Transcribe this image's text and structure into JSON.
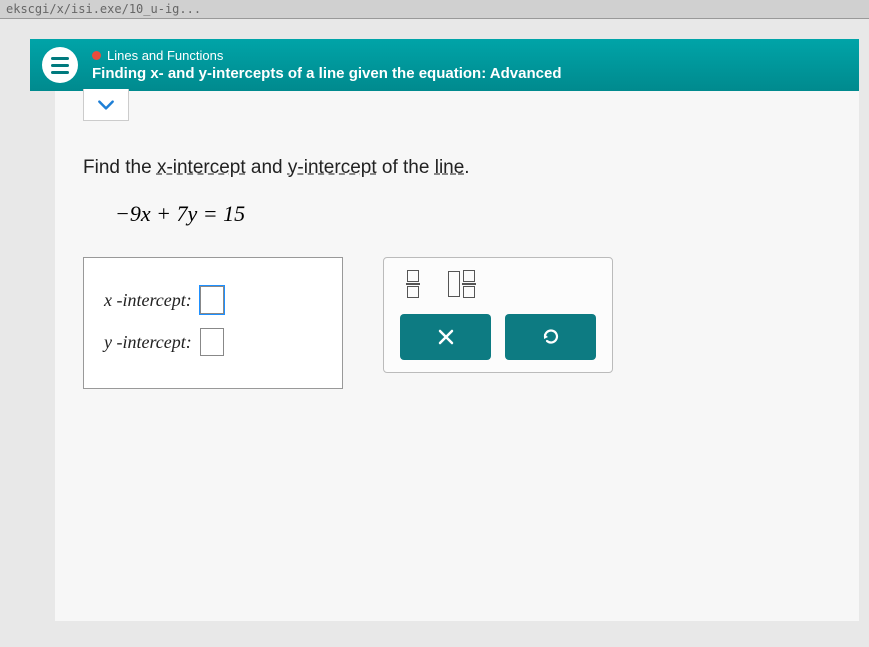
{
  "url_fragment": "ekscgi/x/isi.exe/10_u-ig...",
  "header": {
    "category": "Lines and Functions",
    "title": "Finding x- and y-intercepts of a line given the equation: Advanced"
  },
  "question": {
    "prefix": "Find the ",
    "xterm": "x-intercept",
    "mid": " and ",
    "yterm": "y-intercept",
    "suffix1": " of the ",
    "line": "line",
    "suffix2": "."
  },
  "equation": "−9x + 7y = 15",
  "answers": {
    "x_label": "x -intercept:",
    "y_label": "y -intercept:",
    "x_value": "",
    "y_value": ""
  },
  "tools": {
    "fraction": "fraction",
    "mixed_fraction": "mixed-fraction",
    "clear": "×",
    "reset": "↺"
  }
}
